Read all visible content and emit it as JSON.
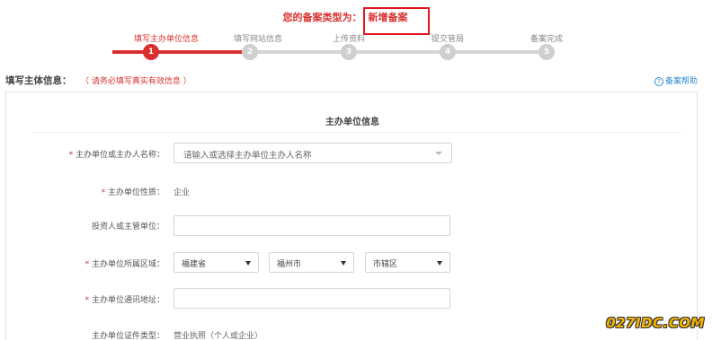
{
  "filing_type": {
    "label": "您的备案类型为：",
    "value": "新增备案"
  },
  "steps": [
    {
      "number": "1",
      "label": "填写主办单位信息",
      "active": true
    },
    {
      "number": "2",
      "label": "填写网站信息",
      "active": false
    },
    {
      "number": "3",
      "label": "上传资料",
      "active": false
    },
    {
      "number": "4",
      "label": "提交管局",
      "active": false
    },
    {
      "number": "5",
      "label": "备案完成",
      "active": false
    }
  ],
  "section": {
    "title": "填写主体信息：",
    "hint": "（ 请务必填写真实有效信息 ）",
    "help_label": "备案帮助"
  },
  "panel_title": "主办单位信息",
  "form": {
    "owner_name": {
      "required_mark": "*",
      "label": "主办单位或主办人名称：",
      "placeholder": "请输入或选择主办单位主办人名称"
    },
    "owner_nature": {
      "required_mark": "*",
      "label": "主办单位性质：",
      "value": "企业"
    },
    "investor": {
      "label": "投资人或主管单位：",
      "value": ""
    },
    "region": {
      "required_mark": "*",
      "label": "主办单位所属区域：",
      "province": "福建省",
      "city": "福州市",
      "district": "市辖区"
    },
    "address": {
      "required_mark": "*",
      "label": "主办单位通讯地址：",
      "value": ""
    },
    "cert_type": {
      "label": "主办单位证件类型：",
      "value": "营业执照（个人或企业）"
    }
  },
  "watermark": "027IDC.COM",
  "colors": {
    "accent": "#d9302f",
    "link": "#2f8ad1",
    "inactive_step": "#cfcfcf"
  }
}
